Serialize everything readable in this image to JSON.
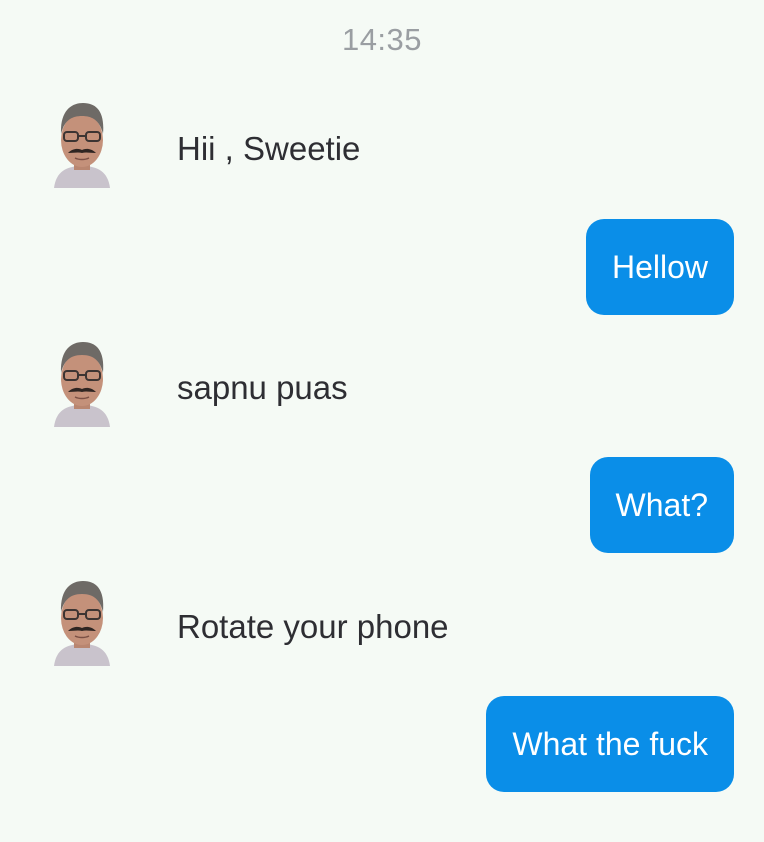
{
  "chat": {
    "timestamp": "14:35",
    "messages": [
      {
        "direction": "incoming",
        "text": "Hii , Sweetie",
        "avatar_icon": "man-portrait-avatar"
      },
      {
        "direction": "outgoing",
        "text": "Hellow"
      },
      {
        "direction": "incoming",
        "text": "sapnu puas",
        "avatar_icon": "man-portrait-avatar"
      },
      {
        "direction": "outgoing",
        "text": "What?"
      },
      {
        "direction": "incoming",
        "text": "Rotate your phone",
        "avatar_icon": "man-portrait-avatar"
      },
      {
        "direction": "outgoing",
        "text": "What the fuck"
      }
    ]
  },
  "colors": {
    "background": "#f5faf5",
    "outgoing_bubble": "#0a8ee8",
    "outgoing_text": "#ffffff",
    "incoming_text": "#2e2e33",
    "timestamp_text": "#9a9ea2"
  }
}
